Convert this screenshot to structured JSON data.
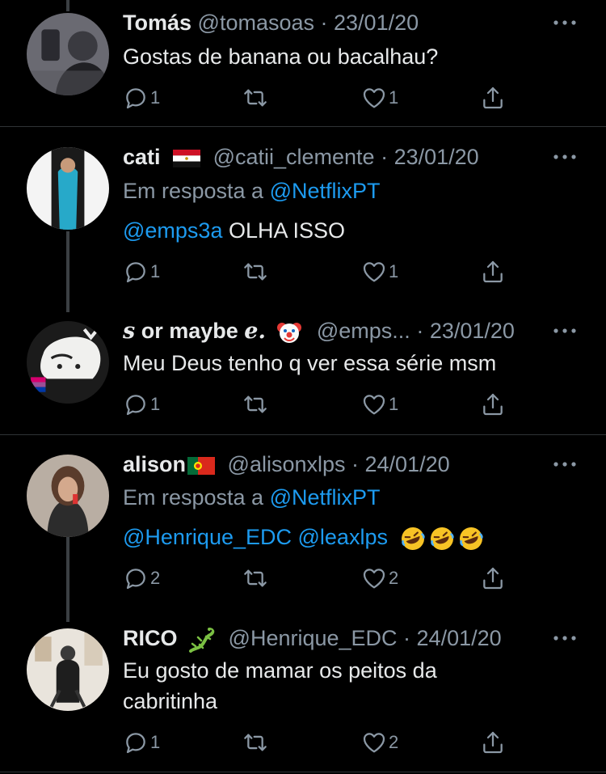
{
  "tweets": [
    {
      "name": "Tomás",
      "handle": "@tomasoas",
      "sep": " · ",
      "date": "23/01/20",
      "text": "Gostas de banana ou bacalhau?",
      "reply": "1",
      "retweet": "",
      "like": "1"
    },
    {
      "name": "cati",
      "handle": "@catii_clemente",
      "sep": " · ",
      "date": "23/01/20",
      "reply_prefix": "Em resposta a ",
      "reply_to": "@NetflixPT",
      "mention": "@emps3a",
      "text": " OLHA ISSO",
      "reply": "1",
      "retweet": "",
      "like": "1"
    },
    {
      "name_a": "s",
      "name_b": " or maybe ",
      "name_c": "e.",
      "handle": "@emps...",
      "sep": " · ",
      "date": "23/01/20",
      "text": "Meu Deus tenho q ver essa série msm",
      "reply": "1",
      "retweet": "",
      "like": "1"
    },
    {
      "name": "alison",
      "handle": "@alisonxlps",
      "sep": " · ",
      "date": "24/01/20",
      "reply_prefix": "Em resposta a ",
      "reply_to": "@NetflixPT",
      "mention1": "@Henrique_EDC",
      "mention2": " @leaxlps",
      "reply": "2",
      "retweet": "",
      "like": "2"
    },
    {
      "name": "RICO",
      "handle": "@Henrique_EDC",
      "sep": " · ",
      "date": "24/01/20",
      "text_line1": "Eu gosto de mamar os peitos da",
      "text_line2": "cabritinha",
      "reply": "1",
      "retweet": "",
      "like": "2"
    }
  ],
  "colors": {
    "background": "#000000",
    "text": "#e7e9ea",
    "secondary": "#8b98a5",
    "link": "#1d9bf0",
    "divider": "#2f3336"
  },
  "icons": [
    "reply-icon",
    "retweet-icon",
    "like-icon",
    "share-icon",
    "more-icon",
    "flag-egypt-icon",
    "flag-portugal-icon",
    "clown-emoji-icon",
    "laughing-emoji-icon",
    "lizard-emoji-icon"
  ]
}
